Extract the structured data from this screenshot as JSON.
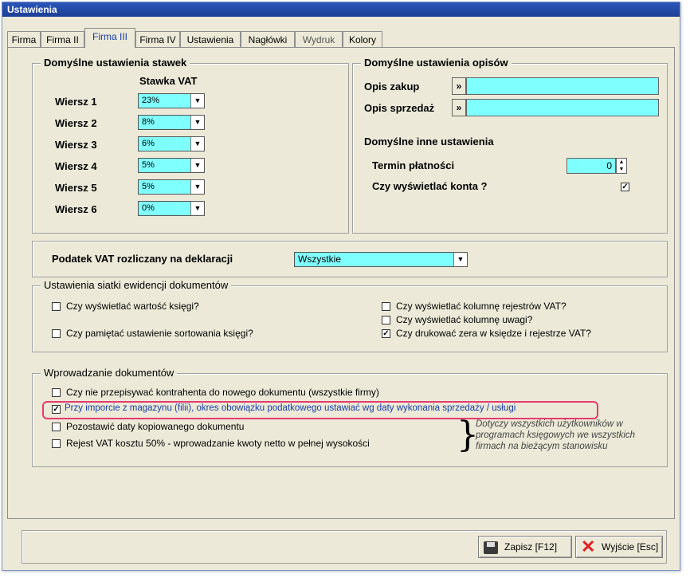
{
  "window": {
    "title": "Ustawienia"
  },
  "tabs": [
    "Firma",
    "Firma II",
    "Firma III",
    "Firma IV",
    "Ustawienia",
    "Nagłówki",
    "Wydruk",
    "Kolory"
  ],
  "rates": {
    "legend": "Domyślne ustawienia stawek",
    "column_header": "Stawka VAT",
    "rows": [
      {
        "label": "Wiersz 1",
        "value": "23%"
      },
      {
        "label": "Wiersz 2",
        "value": "8%"
      },
      {
        "label": "Wiersz 3",
        "value": "6%"
      },
      {
        "label": "Wiersz 4",
        "value": "5%"
      },
      {
        "label": "Wiersz 5",
        "value": "5%"
      },
      {
        "label": "Wiersz 6",
        "value": "0%"
      }
    ]
  },
  "descriptions": {
    "legend": "Domyślne ustawienia opisów",
    "opis_zakup": "Opis zakup",
    "opis_sprzedaz": "Opis sprzedaż",
    "btn_symbol": "»",
    "other_header": "Domyślne inne ustawienia",
    "termin_label": "Termin płatności",
    "termin_value": "0",
    "konta_label": "Czy wyświetlać konta ?"
  },
  "vat_decl": {
    "label": "Podatek VAT rozliczany na deklaracji",
    "value": "Wszystkie"
  },
  "grid": {
    "legend": "Ustawienia siatki  ewidencji dokumentów",
    "items": [
      {
        "label": "Czy wyświetlać wartość księgi?",
        "checked": ""
      },
      {
        "label": "Czy pamiętać ustawienie sortowania księgi?",
        "checked": ""
      },
      {
        "label": "Czy wyświetlać kolumnę rejestrów VAT?",
        "checked": ""
      },
      {
        "label": "Czy wyświetlać kolumnę uwagi?",
        "checked": ""
      },
      {
        "label": "Czy drukować zera w księdze i rejestrze VAT?",
        "checked": "✓"
      }
    ]
  },
  "entry": {
    "legend": "Wprowadzanie dokumentów",
    "items": [
      {
        "label": "Czy nie przepisywać kontrahenta do nowego dokumentu (wszystkie firmy)",
        "checked": ""
      },
      {
        "label": "Przy imporcie z magazynu (filii), okres obowiązku podatkowego ustawiać wg daty wykonania sprzedaży / usługi",
        "checked": "✓"
      },
      {
        "label": "Pozostawić daty kopiowanego dokumentu",
        "checked": ""
      },
      {
        "label": "Rejest VAT kosztu 50% - wprowadzanie kwoty netto w pełnej wysokości",
        "checked": ""
      }
    ],
    "note": "Dotyczy wszystkich użytkowników w programach księgowych we wszystkich firmach na bieżącym stanowisku"
  },
  "buttons": {
    "save": "Zapisz  [F12]",
    "exit": "Wyjście  [Esc]"
  },
  "colors": {
    "accent": "#1a3fa8",
    "field": "#80ffff",
    "highlight": "#e63a6e"
  }
}
